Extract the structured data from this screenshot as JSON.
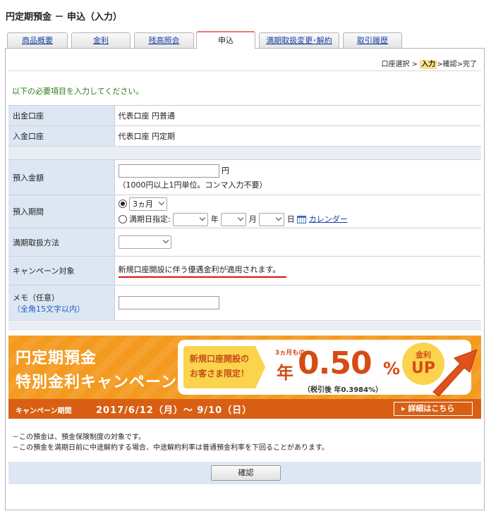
{
  "page_title": "円定期預金 － 申込（入力）",
  "tabs": [
    {
      "label": "商品概要"
    },
    {
      "label": "金利"
    },
    {
      "label": "残高照会"
    },
    {
      "label": "申込"
    },
    {
      "label": "満期取扱変更･解約"
    },
    {
      "label": "取引履歴"
    }
  ],
  "active_tab": "申込",
  "steps": {
    "s1": "口座選択",
    "sep": ">",
    "s2": "入力",
    "s3": "確認",
    "s4": "完了"
  },
  "instruction": "以下の必要項目を入力してください。",
  "accounts": {
    "withdraw_label": "出金口座",
    "withdraw_value": "代表口座 円普通",
    "deposit_label": "入金口座",
    "deposit_value": "代表口座 円定期"
  },
  "form": {
    "amount_label": "預入金額",
    "amount_value": "",
    "amount_unit": "円",
    "amount_hint": "（1000円以上1円単位。コンマ入力不要）",
    "period_label": "預入期間",
    "period_selected": "3ヵ月",
    "maturity_date_label": "満期日指定:",
    "year_unit": "年",
    "month_unit": "月",
    "day_unit": "日",
    "calendar_link": "カレンダー",
    "maturity_method_label": "満期取扱方法",
    "campaign_label": "キャンペーン対象",
    "campaign_text": "新規口座開設に伴う優遇金利が適用されます。",
    "memo_label": "メモ（任意）",
    "memo_hint": "（全角15文字以内）",
    "memo_value": ""
  },
  "banner": {
    "title_line1": "円定期預金",
    "title_line2": "特別金利キャンペーン",
    "badge_line1": "新規口座開設の",
    "badge_line2": "お客さま限定！",
    "small": "3ヵ月もの",
    "year": "年",
    "rate": "0.50",
    "percent": "%",
    "after_tax": "（税引後 年0.3984%）",
    "circle_top": "金利",
    "circle_bottom": "UP",
    "period_label": "キャンペーン期間",
    "period": "2017/6/12（月）～ 9/10（日）",
    "detail_link": "詳細はこちら"
  },
  "notes": [
    "－この預金は、預金保険制度の対象です。",
    "－この預金を満期日前に中途解約する場合、中途解約利率は普通預金利率を下回ることがあります。"
  ],
  "confirm_label": "確認",
  "colors": {
    "accent_orange": "#f39a1f",
    "deep_orange": "#d95f14",
    "label_bg": "#dde7f3",
    "link": "#1a3fa3",
    "green_text": "#2a7a1a"
  }
}
